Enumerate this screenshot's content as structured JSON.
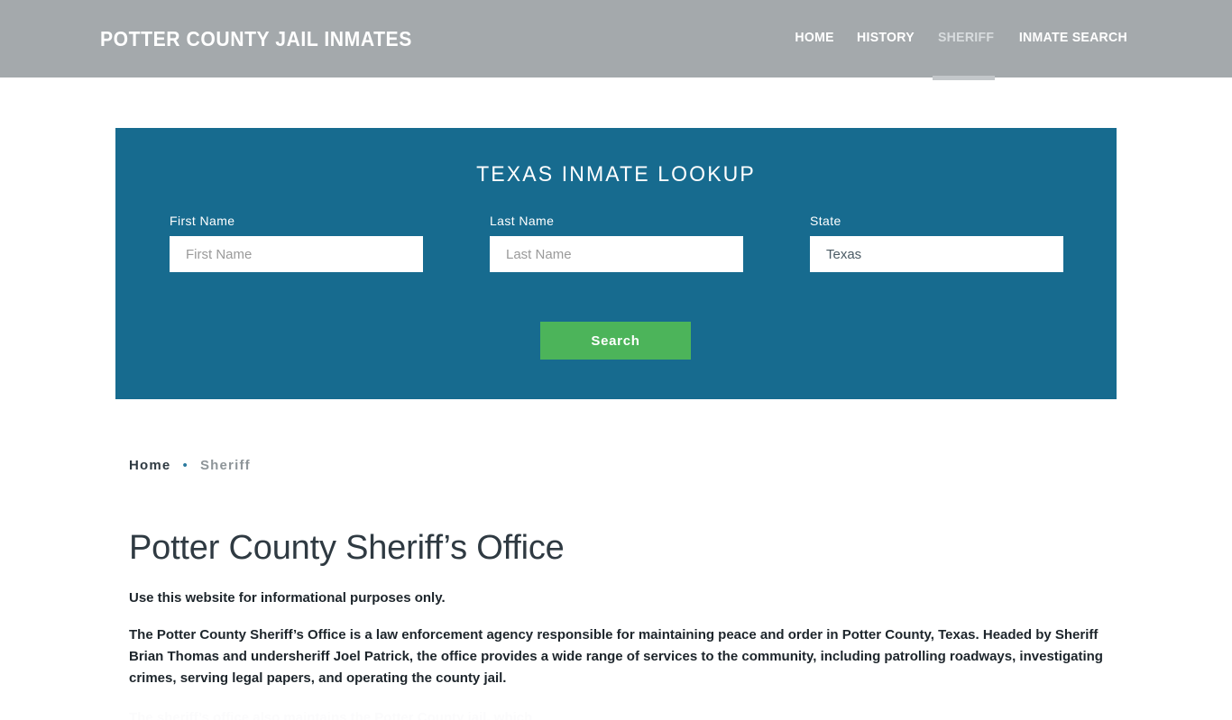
{
  "header": {
    "brand": "POTTER COUNTY JAIL INMATES",
    "nav": [
      {
        "label": "HOME",
        "active": false
      },
      {
        "label": "HISTORY",
        "active": false
      },
      {
        "label": "SHERIFF",
        "active": true
      },
      {
        "label": "INMATE SEARCH",
        "active": false
      }
    ],
    "background_color": "#a4a9ac"
  },
  "lookup": {
    "title": "TEXAS INMATE LOOKUP",
    "panel_color": "#176b8f",
    "fields": {
      "first_name": {
        "label": "First Name",
        "placeholder": "First Name",
        "value": ""
      },
      "last_name": {
        "label": "Last Name",
        "placeholder": "Last Name",
        "value": ""
      },
      "state": {
        "label": "State",
        "placeholder": "State",
        "value": "Texas"
      }
    },
    "search_button": {
      "label": "Search",
      "color": "#4cb45a"
    }
  },
  "breadcrumb": {
    "home": "Home",
    "separator": "•",
    "current": "Sheriff",
    "separator_color": "#2b7a9e"
  },
  "main": {
    "title": "Potter County Sheriff’s Office",
    "lede": "Use this website for informational purposes only.",
    "paragraph": "The Potter County Sheriff’s Office is a law enforcement agency responsible for maintaining peace and order in Potter County, Texas. Headed by Sheriff Brian Thomas and undersheriff Joel Patrick, the office provides a wide range of services to the community, including patrolling roadways, investigating crimes, serving legal papers, and operating the county jail.",
    "paragraph_cut_off": "The sheriff’s office also maintains the Potter County jail, which"
  }
}
